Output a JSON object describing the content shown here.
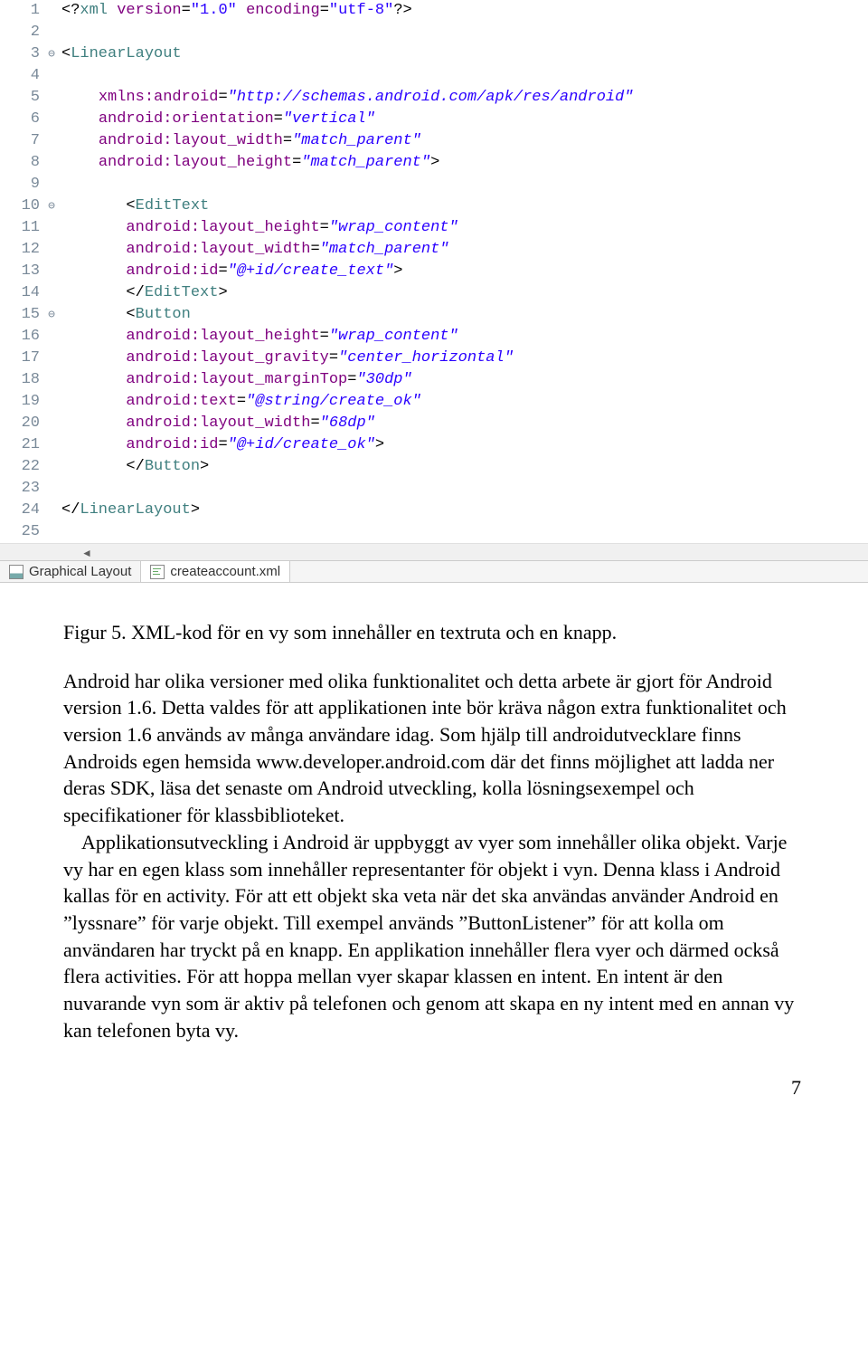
{
  "code": {
    "lines": [
      {
        "n": "1",
        "fold": "",
        "html": "<span class='tk-punct'>&lt;?</span><span class='tk-tag'>xml</span> <span class='tk-attr'>version</span><span class='tk-punct'>=</span><span class='tk-xmlstr'>\"1.0\"</span> <span class='tk-attr'>encoding</span><span class='tk-punct'>=</span><span class='tk-xmlstr'>\"utf-8\"</span><span class='tk-punct'>?&gt;</span>"
      },
      {
        "n": "2",
        "fold": "",
        "html": ""
      },
      {
        "n": "3",
        "fold": "⊖",
        "html": "<span class='tk-punct'>&lt;</span><span class='tk-tag'>LinearLayout</span>"
      },
      {
        "n": "4",
        "fold": "",
        "html": ""
      },
      {
        "n": "5",
        "fold": "",
        "html": "    <span class='tk-attr'>xmlns:android</span><span class='tk-punct'>=</span><span class='tk-str'>\"http://schemas.android.com/apk/res/android\"</span>"
      },
      {
        "n": "6",
        "fold": "",
        "html": "    <span class='tk-attr'>android:orientation</span><span class='tk-punct'>=</span><span class='tk-str'>\"vertical\"</span>"
      },
      {
        "n": "7",
        "fold": "",
        "html": "    <span class='tk-attr'>android:layout_width</span><span class='tk-punct'>=</span><span class='tk-str'>\"match_parent\"</span>"
      },
      {
        "n": "8",
        "fold": "",
        "html": "    <span class='tk-attr'>android:layout_height</span><span class='tk-punct'>=</span><span class='tk-str'>\"match_parent\"</span><span class='tk-punct'>&gt;</span>"
      },
      {
        "n": "9",
        "fold": "",
        "html": ""
      },
      {
        "n": "10",
        "fold": "⊖",
        "html": "       <span class='tk-punct'>&lt;</span><span class='tk-tag'>EditText</span>"
      },
      {
        "n": "11",
        "fold": "",
        "html": "       <span class='tk-attr'>android:layout_height</span><span class='tk-punct'>=</span><span class='tk-str'>\"wrap_content\"</span>"
      },
      {
        "n": "12",
        "fold": "",
        "html": "       <span class='tk-attr'>android:layout_width</span><span class='tk-punct'>=</span><span class='tk-str'>\"match_parent\"</span>"
      },
      {
        "n": "13",
        "fold": "",
        "html": "       <span class='tk-attr'>android:id</span><span class='tk-punct'>=</span><span class='tk-str'>\"@+id/create_text\"</span><span class='tk-punct'>&gt;</span>"
      },
      {
        "n": "14",
        "fold": "",
        "html": "       <span class='tk-punct'>&lt;/</span><span class='tk-tag'>EditText</span><span class='tk-punct'>&gt;</span>"
      },
      {
        "n": "15",
        "fold": "⊖",
        "html": "       <span class='tk-punct'>&lt;</span><span class='tk-tag'>Button</span>"
      },
      {
        "n": "16",
        "fold": "",
        "html": "       <span class='tk-attr'>android:layout_height</span><span class='tk-punct'>=</span><span class='tk-str'>\"wrap_content\"</span>"
      },
      {
        "n": "17",
        "fold": "",
        "html": "       <span class='tk-attr'>android:layout_gravity</span><span class='tk-punct'>=</span><span class='tk-str'>\"center_horizontal\"</span>"
      },
      {
        "n": "18",
        "fold": "",
        "html": "       <span class='tk-attr'>android:layout_marginTop</span><span class='tk-punct'>=</span><span class='tk-str'>\"30dp\"</span>"
      },
      {
        "n": "19",
        "fold": "",
        "html": "       <span class='tk-attr'>android:text</span><span class='tk-punct'>=</span><span class='tk-str'>\"@string/create_ok\"</span>"
      },
      {
        "n": "20",
        "fold": "",
        "html": "       <span class='tk-attr'>android:layout_width</span><span class='tk-punct'>=</span><span class='tk-str'>\"68dp\"</span>"
      },
      {
        "n": "21",
        "fold": "",
        "html": "       <span class='tk-attr'>android:id</span><span class='tk-punct'>=</span><span class='tk-str'>\"@+id/create_ok\"</span><span class='tk-punct'>&gt;</span>"
      },
      {
        "n": "22",
        "fold": "",
        "html": "       <span class='tk-punct'>&lt;/</span><span class='tk-tag'>Button</span><span class='tk-punct'>&gt;</span>"
      },
      {
        "n": "23",
        "fold": "",
        "html": ""
      },
      {
        "n": "24",
        "fold": "",
        "html": "<span class='tk-punct'>&lt;/</span><span class='tk-tag'>LinearLayout</span><span class='tk-punct'>&gt;</span>"
      },
      {
        "n": "25",
        "fold": "",
        "html": ""
      }
    ]
  },
  "tabs": {
    "graphical": "Graphical Layout",
    "file": "createaccount.xml"
  },
  "doc": {
    "caption": "Figur 5. XML-kod för en vy som innehåller en textruta och en knapp.",
    "p1": "Android har olika versioner med olika funktionalitet och detta arbete är gjort för Android version 1.6. Detta valdes för att applikationen inte bör kräva någon extra funktionalitet och version 1.6 används av många användare idag. Som hjälp till androidutvecklare finns Androids egen hemsida www.developer.android.com där det finns möjlighet att ladda ner deras SDK, läsa det senaste om Android utveckling, kolla lösningsexempel och specifikationer för klassbiblioteket.",
    "p2": "Applikationsutveckling i Android är uppbyggt av vyer som innehåller olika objekt. Varje vy har en egen klass som innehåller representanter för objekt i vyn. Denna klass i Android kallas för en activity. För att ett objekt ska veta när det ska användas använder Android en ”lyssnare” för varje objekt. Till exempel används ”ButtonListener” för att kolla om användaren har tryckt på en knapp. En applikation innehåller flera vyer och därmed också flera activities. För att hoppa mellan vyer skapar klassen en intent. En intent är den nuvarande vyn som är aktiv på telefonen och genom att skapa en ny intent med en annan vy kan telefonen byta vy.",
    "page_number": "7"
  }
}
